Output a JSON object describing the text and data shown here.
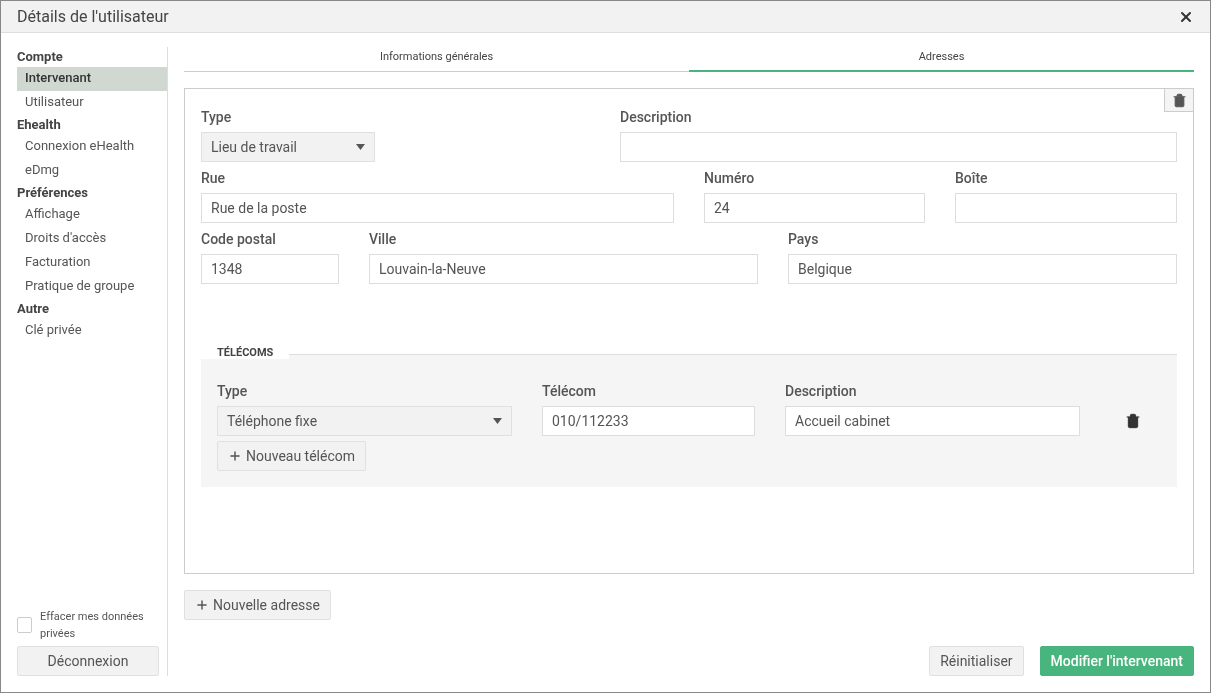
{
  "window": {
    "title": "Détails de l'utilisateur"
  },
  "sidebar": {
    "sections": [
      {
        "title": "Compte",
        "items": [
          {
            "label": "Intervenant",
            "selected": true
          },
          {
            "label": "Utilisateur",
            "selected": false
          }
        ]
      },
      {
        "title": "Ehealth",
        "items": [
          {
            "label": "Connexion eHealth",
            "selected": false
          },
          {
            "label": "eDmg",
            "selected": false
          }
        ]
      },
      {
        "title": "Préférences",
        "items": [
          {
            "label": "Affichage",
            "selected": false
          },
          {
            "label": "Droits d'accès",
            "selected": false
          },
          {
            "label": "Facturation",
            "selected": false
          },
          {
            "label": "Pratique de groupe",
            "selected": false
          }
        ]
      },
      {
        "title": "Autre",
        "items": [
          {
            "label": "Clé privée",
            "selected": false
          }
        ]
      }
    ],
    "erase_checkbox": {
      "label": "Effacer mes données privées",
      "checked": false
    },
    "logout_button": "Déconnexion"
  },
  "tabs": [
    {
      "label": "Informations générales",
      "selected": false
    },
    {
      "label": "Adresses",
      "selected": true
    }
  ],
  "address": {
    "rows": [
      [
        {
          "kind": "select",
          "label": "Type",
          "value": "Lieu de travail"
        },
        {
          "kind": "input",
          "label": "Description"
        }
      ],
      [
        {
          "kind": "input",
          "label": "Rue",
          "value": "Rue de la poste"
        },
        {
          "kind": "input",
          "label": "Numéro",
          "value": "24"
        },
        {
          "kind": "input",
          "label": "Boîte"
        }
      ],
      [
        {
          "kind": "input",
          "label": "Code postal",
          "value": "1348"
        },
        {
          "kind": "input",
          "label": "Ville",
          "value": "Louvain-la-Neuve"
        },
        {
          "kind": "input",
          "label": "Pays",
          "value": "Belgique"
        }
      ]
    ],
    "telecoms": {
      "title": "TÉLÉCOMS",
      "columns": [
        "Type",
        "Télécom",
        "Description"
      ],
      "rows": [
        {
          "type": "Téléphone fixe",
          "telecom": "010/112233",
          "description": "Accueil cabinet"
        }
      ],
      "add_button": "Nouveau télécom"
    }
  },
  "add_address_button": "Nouvelle adresse",
  "footer_buttons": [
    {
      "kind": "secondary",
      "label": "Réinitialiser"
    },
    {
      "kind": "primary",
      "label": "Modifier l'intervenant"
    }
  ]
}
